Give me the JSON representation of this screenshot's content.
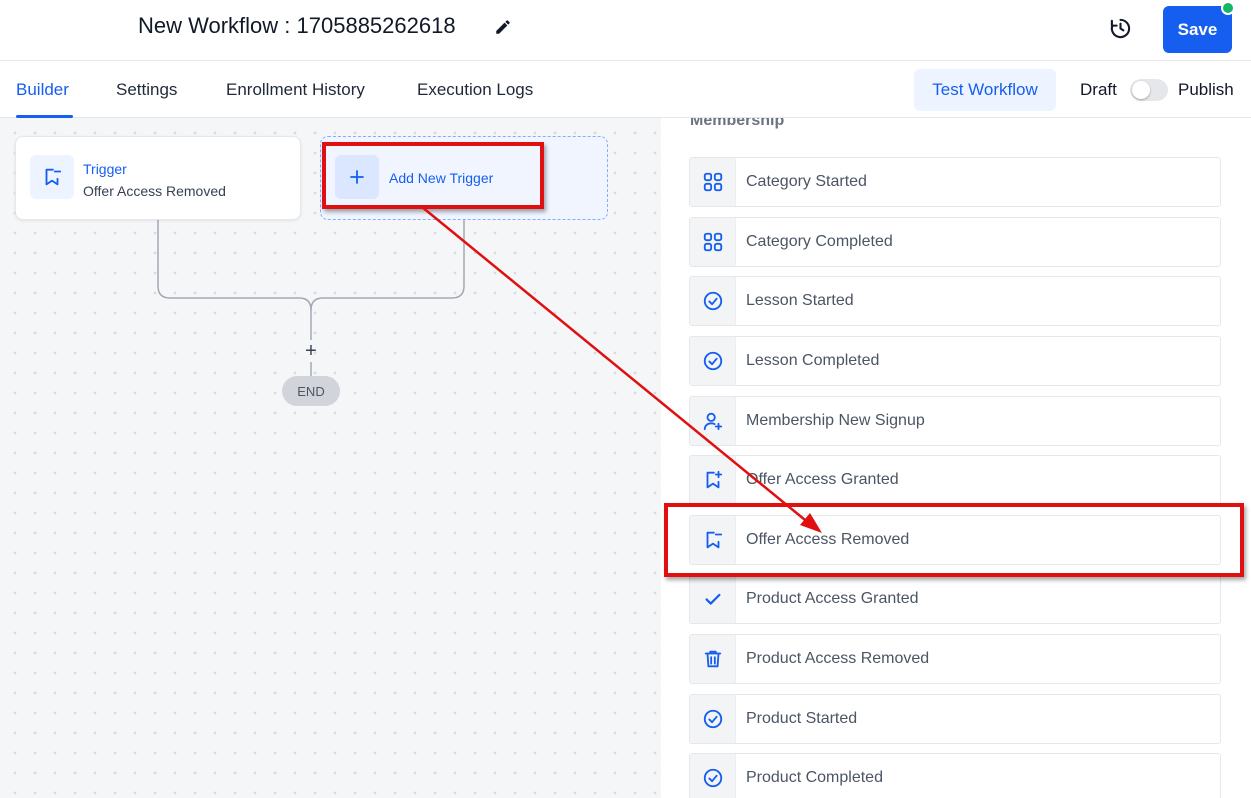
{
  "header": {
    "title": "New Workflow : 1705885262618",
    "save_label": "Save"
  },
  "tabs": [
    {
      "label": "Builder",
      "active": true
    },
    {
      "label": "Settings",
      "active": false
    },
    {
      "label": "Enrollment History",
      "active": false
    },
    {
      "label": "Execution Logs",
      "active": false
    }
  ],
  "toolbar": {
    "test_workflow_label": "Test Workflow",
    "draft_label": "Draft",
    "publish_label": "Publish",
    "publish_enabled": false
  },
  "canvas": {
    "trigger_title": "Trigger",
    "trigger_subtitle": "Offer Access Removed",
    "add_trigger_label": "Add New Trigger",
    "plus_label": "+",
    "end_label": "END"
  },
  "panel": {
    "section_heading": "Membership",
    "items": [
      {
        "label": "Category Started",
        "icon": "grid-icon"
      },
      {
        "label": "Category Completed",
        "icon": "grid-icon"
      },
      {
        "label": "Lesson Started",
        "icon": "check-circle-icon"
      },
      {
        "label": "Lesson Completed",
        "icon": "check-circle-icon"
      },
      {
        "label": "Membership New Signup",
        "icon": "user-plus-icon"
      },
      {
        "label": "Offer Access Granted",
        "icon": "bookmark-plus-icon"
      },
      {
        "label": "Offer Access Removed",
        "icon": "bookmark-minus-icon"
      },
      {
        "label": "Product Access Granted",
        "icon": "check-icon"
      },
      {
        "label": "Product Access Removed",
        "icon": "trash-icon"
      },
      {
        "label": "Product Started",
        "icon": "check-circle-icon"
      },
      {
        "label": "Product Completed",
        "icon": "check-circle-icon"
      }
    ]
  },
  "colors": {
    "primary": "#155eef",
    "annotation": "#e01010",
    "status_dot": "#12b76a"
  }
}
